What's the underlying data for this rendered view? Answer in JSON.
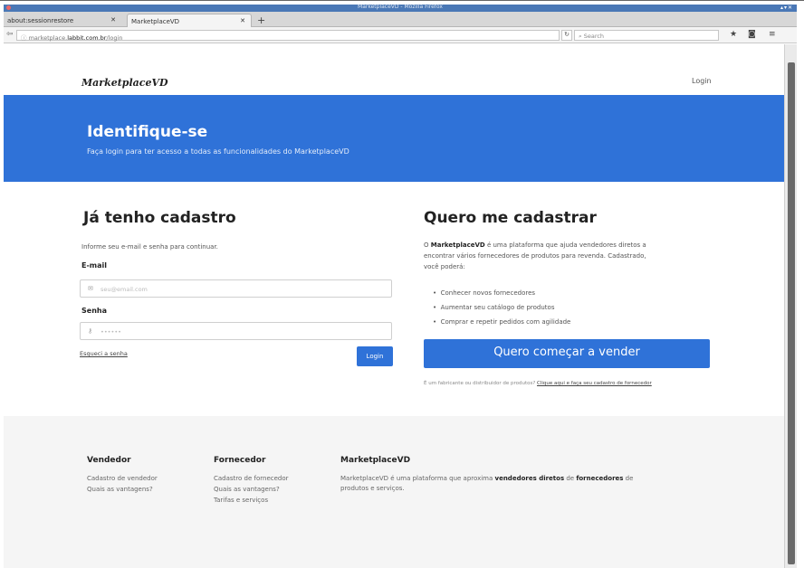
{
  "window": {
    "title": "MarketplaceVD - Mozilla Firefox",
    "controls": "▴▾✕"
  },
  "tabs": [
    {
      "label": "about:sessionrestore"
    },
    {
      "label": "MarketplaceVD"
    }
  ],
  "nav": {
    "url_prefix": "marketplace.",
    "url_host": "labbit.com.br",
    "url_path": "/login",
    "search_placeholder": "Search"
  },
  "header": {
    "logo": "MarketplaceVD",
    "login": "Login"
  },
  "hero": {
    "title": "Identifique-se",
    "subtitle": "Faça login para ter acesso a todas as funcionalidades do MarketplaceVD"
  },
  "login_section": {
    "title": "Já tenho cadastro",
    "intro": "Informe seu e-mail e senha para continuar.",
    "email_label": "E-mail",
    "email_placeholder": "seu@email.com",
    "password_label": "Senha",
    "password_placeholder": "••••••",
    "forgot": "Esqueci a senha",
    "login_button": "Login"
  },
  "signup_section": {
    "title": "Quero me cadastrar",
    "desc_brand": "MarketplaceVD",
    "desc_line1_a": "O ",
    "desc_line1_b": " é uma plataforma que ajuda vendedores diretos a",
    "desc_line2": "encontrar vários fornecedores de produtos para revenda. Cadastrado,",
    "desc_line3": "você poderá:",
    "bullets": [
      "Conhecer novos fornecedores",
      "Aumentar seu catálogo de produtos",
      "Comprar e repetir pedidos com agilidade"
    ],
    "cta_button": "Quero começar a vender",
    "manufacturer_text": "É um fabricante ou distribuidor de produtos?",
    "manufacturer_link": "Clique aqui e faça seu cadastro de fornecedor"
  },
  "footer": {
    "col1": {
      "title": "Vendedor",
      "links": [
        "Cadastro de vendedor",
        "Quais as vantagens?"
      ]
    },
    "col2": {
      "title": "Fornecedor",
      "links": [
        "Cadastro de fornecedor",
        "Quais as vantagens?",
        "Tarifas e serviços"
      ]
    },
    "col3": {
      "title": "MarketplaceVD",
      "text_a": "MarketplaceVD é uma plataforma que aproxima ",
      "text_b": "vendedores diretos",
      "text_c": " de ",
      "text_d": "fornecedores",
      "text_e": " de",
      "text_line2": "produtos e serviços."
    }
  }
}
